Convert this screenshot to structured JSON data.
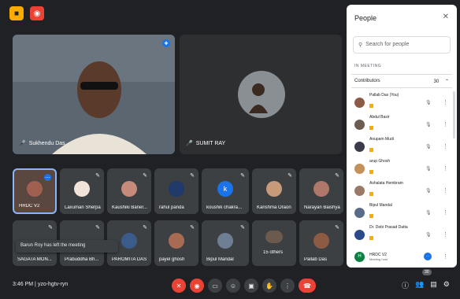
{
  "topbar": {
    "btn1": "■",
    "btn2": "◉"
  },
  "main_speaker": {
    "name": "Sukhendu Das"
  },
  "second_speaker": {
    "name": "SUMIT RAY"
  },
  "tiles": [
    {
      "name": "HRDC V2",
      "initial": ""
    },
    {
      "name": "Laxuman Sherpa",
      "initial": ""
    },
    {
      "name": "Kaushiki Baner...",
      "initial": ""
    },
    {
      "name": "rahul panda",
      "initial": ""
    },
    {
      "name": "koushik chakra...",
      "initial": "k"
    },
    {
      "name": "Karishma Oraon",
      "initial": ""
    },
    {
      "name": "Narayan Baishya",
      "initial": ""
    },
    {
      "name": "SAGATA MON...",
      "initial": ""
    },
    {
      "name": "Prabuddha Bh...",
      "initial": ""
    },
    {
      "name": "PAROMITA DAS",
      "initial": ""
    },
    {
      "name": "payel ghosh",
      "initial": ""
    },
    {
      "name": "Bipul Mandal",
      "initial": ""
    },
    {
      "name": "15 others",
      "initial": ""
    },
    {
      "name": "Pallab Das",
      "initial": ""
    }
  ],
  "toast": "Barun Roy has left the meeting",
  "meeting": {
    "time": "3:46 PM",
    "separator": "|",
    "code": "yzo-hgtv-ryn"
  },
  "participants_count_badge": "30",
  "panel": {
    "title": "People",
    "search_placeholder": "Search for people",
    "in_meeting": "IN MEETING",
    "contributors_label": "Contributors",
    "contributors_count": "30",
    "people": [
      {
        "name": "Pallab Das (You)",
        "sub": ""
      },
      {
        "name": "Abdul Basir",
        "sub": ""
      },
      {
        "name": "Anupam Mudi",
        "sub": ""
      },
      {
        "name": "arup Ghosh",
        "sub": ""
      },
      {
        "name": "Ashalata Hembram",
        "sub": ""
      },
      {
        "name": "Bipul Mandal",
        "sub": ""
      },
      {
        "name": "Dr. Debi Prasad Datta",
        "sub": ""
      },
      {
        "name": "HRDC V2",
        "sub": "Meeting host",
        "initial": "H"
      }
    ]
  },
  "colors": {
    "accent": "#1a73e8",
    "danger": "#ea4335",
    "tag": "#f9ab00"
  }
}
